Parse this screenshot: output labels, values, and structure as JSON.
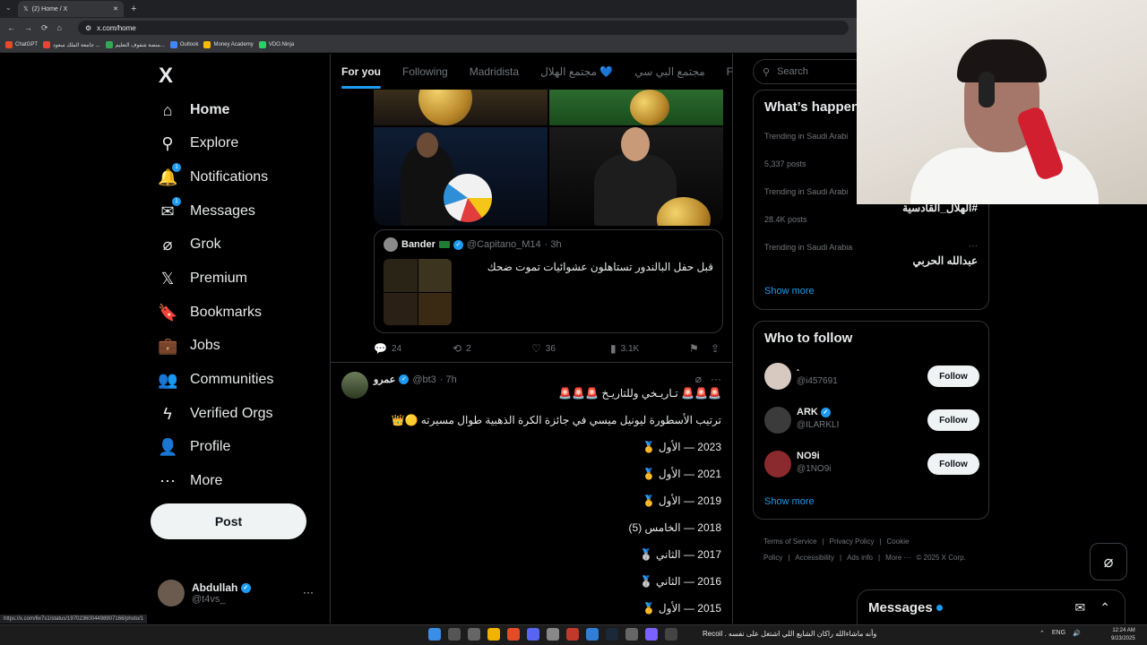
{
  "browser": {
    "tab_title": "(2) Home / X",
    "new_tab": "+",
    "url": "x.com/home",
    "bookmarks": [
      "ChatGPT",
      "جامعة الملك سعود ...",
      "منصة شفوف التعليم...",
      "Outlook",
      "Money Academy",
      "VDO.Ninja"
    ],
    "status_url": "https://x.com/6x7s1/status/1970236004498907166/photo/1"
  },
  "nav": {
    "logo": "X",
    "items": [
      {
        "label": "Home",
        "icon": "home-icon",
        "glyph": "⌂"
      },
      {
        "label": "Explore",
        "icon": "search-icon",
        "glyph": "⚲"
      },
      {
        "label": "Notifications",
        "icon": "bell-icon",
        "glyph": "🔔",
        "badge": "1"
      },
      {
        "label": "Messages",
        "icon": "mail-icon",
        "glyph": "✉",
        "badge": "1"
      },
      {
        "label": "Grok",
        "icon": "grok-icon",
        "glyph": "⌀"
      },
      {
        "label": "Premium",
        "icon": "x-premium-icon",
        "glyph": "𝕏"
      },
      {
        "label": "Bookmarks",
        "icon": "bookmark-icon",
        "glyph": "🔖"
      },
      {
        "label": "Jobs",
        "icon": "briefcase-icon",
        "glyph": "💼"
      },
      {
        "label": "Communities",
        "icon": "communities-icon",
        "glyph": "👥"
      },
      {
        "label": "Verified Orgs",
        "icon": "lightning-icon",
        "glyph": "ϟ"
      },
      {
        "label": "Profile",
        "icon": "person-icon",
        "glyph": "👤"
      },
      {
        "label": "More",
        "icon": "more-circle-icon",
        "glyph": "⋯"
      }
    ],
    "post_label": "Post",
    "account": {
      "name": "Abdullah",
      "handle": "@t4vs_",
      "more": "···"
    }
  },
  "feed": {
    "tabs": [
      "For you",
      "Following",
      "Madridista",
      "مجتمع الهلال 💙",
      "مجتمع البي سي",
      "Fal"
    ],
    "post1": {
      "quote": {
        "name": "Bander",
        "handle": "@Capitano_M14",
        "time": "· 3h",
        "text": "قبل حفل البالندور تستاهلون عشوائيات تموت ضحك"
      },
      "actions": {
        "replies": "24",
        "reposts": "2",
        "likes": "36",
        "views": "3.1K"
      }
    },
    "post2": {
      "name": "عمرو",
      "handle": "@bt3",
      "time": "· 7h",
      "lines": [
        "🚨🚨🚨 تـاريـخي وللتاريـخ 🚨🚨🚨",
        "ترتيب الأسطورة ليونيل ميسي في جائزة الكرة الذهبية طوال مسيرته 🟡👑",
        "2023 — الأول 🥇",
        "2021 — الأول 🥇",
        "2019 — الأول 🥇",
        "2018 — الخامس (5)",
        "2017 — الثاني 🥈",
        "2016 — الثاني 🥈",
        "2015 — الأول 🥇"
      ]
    }
  },
  "sidebar": {
    "search_placeholder": "Search",
    "trends_title": "What’s happen",
    "trends": [
      {
        "meta": "Trending in Saudi Arabi",
        "name": "",
        "posts": "5,337 posts"
      },
      {
        "meta": "Trending in Saudi Arabi",
        "name": "#الهلال_القادسية",
        "posts": "28.4K posts"
      },
      {
        "meta": "Trending in Saudi Arabia",
        "name": "عبدالله الحربي",
        "posts": ""
      }
    ],
    "show_more": "Show more",
    "who_title": "Who to follow",
    "follow": [
      {
        "name": ".",
        "handle": "@i457691",
        "button": "Follow",
        "color": "#d8c9c0"
      },
      {
        "name": "ARK",
        "handle": "@ILARKLI",
        "button": "Follow",
        "color": "#3b3b3b",
        "verified": true
      },
      {
        "name": "NO9i",
        "handle": "@1NO9i",
        "button": "Follow",
        "color": "#8a2a2e"
      }
    ],
    "footer": [
      "Terms of Service",
      "|",
      "Privacy Policy",
      "|",
      "Cookie Policy",
      "|",
      "Accessibility",
      "|",
      "Ads info",
      "|",
      "More ···",
      "© 2025 X Corp."
    ]
  },
  "dock": {
    "messages_title": "Messages"
  },
  "taskbar": {
    "ticker": "وأنه ماشاءالله راكان الشايع اللي اشتغل على نفسه . Recoil",
    "lang": "ENG",
    "time": "12:24 AM",
    "date": "9/23/2025"
  },
  "colors": {
    "accent": "#1d9bf0",
    "background": "#000000",
    "border": "#2f3336",
    "muted": "#71767b"
  }
}
